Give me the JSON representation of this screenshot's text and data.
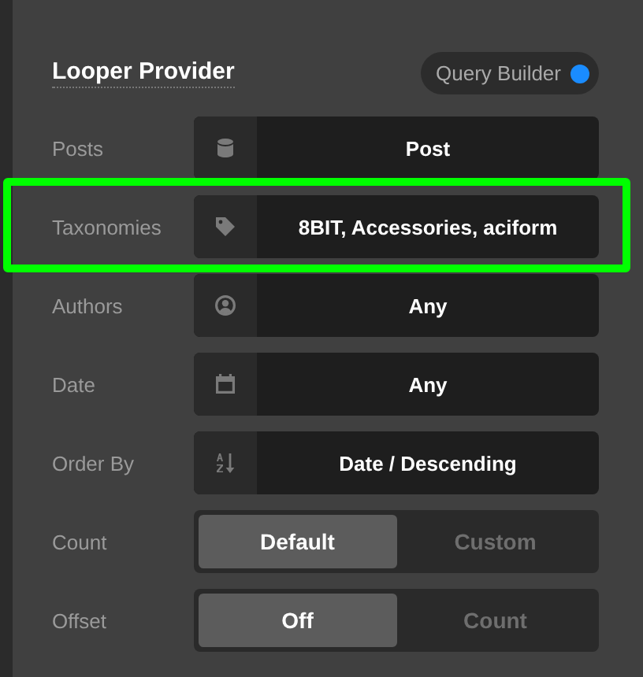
{
  "panel": {
    "title": "Looper Provider",
    "toggle": {
      "label": "Query Builder",
      "on": true
    }
  },
  "rows": [
    {
      "kind": "select",
      "label": "Posts",
      "value": "Post",
      "highlighted": false
    },
    {
      "kind": "select",
      "label": "Taxonomies",
      "value": "8BIT, Accessories, aciform",
      "highlighted": true
    },
    {
      "kind": "select",
      "label": "Authors",
      "value": "Any",
      "highlighted": false
    },
    {
      "kind": "select",
      "label": "Date",
      "value": "Any",
      "highlighted": false
    },
    {
      "kind": "select",
      "label": "Order By",
      "value": "Date / Descending",
      "highlighted": false
    },
    {
      "kind": "segmented",
      "label": "Count",
      "options": [
        {
          "label": "Default",
          "selected": true
        },
        {
          "label": "Custom",
          "selected": false
        }
      ]
    },
    {
      "kind": "segmented",
      "label": "Offset",
      "options": [
        {
          "label": "Off",
          "selected": true
        },
        {
          "label": "Count",
          "selected": false
        }
      ]
    }
  ]
}
